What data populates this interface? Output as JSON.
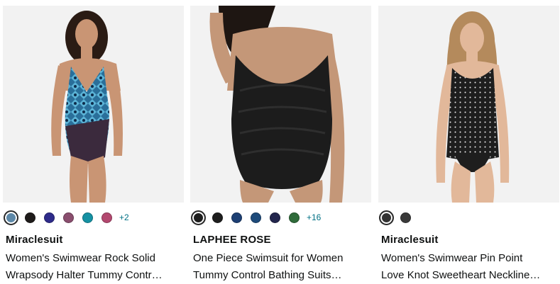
{
  "products": [
    {
      "brand": "Miraclesuit",
      "title_line1": "Women's Swimwear Rock Solid",
      "title_line2": "Wrapsody Halter Tummy Contr…",
      "image": "woman-in-blue-patterned-halter-swimsuit",
      "swatches": [
        "#5d88a8",
        "#1e1b1a",
        "#2e2b8a",
        "#8a4e6e",
        "#1591a3",
        "#b3486f"
      ],
      "more_colors": "+2"
    },
    {
      "brand": "LAPHEE ROSE",
      "title_line1": "One Piece Swimsuit for Women",
      "title_line2": "Tummy Control Bathing Suits…",
      "image": "woman-in-black-ruched-one-piece",
      "swatches": [
        "#1e1e1e",
        "#1e1e1e",
        "#1d3f73",
        "#1e4a7a",
        "#22264d",
        "#2f6b3a"
      ],
      "more_colors": "+16"
    },
    {
      "brand": "Miraclesuit",
      "title_line1": "Women's Swimwear Pin Point",
      "title_line2": "Love Knot Sweetheart Neckline…",
      "image": "woman-in-black-polka-dot-tankini",
      "swatches": [
        "#333333",
        "#3a3a3a"
      ],
      "more_colors": ""
    }
  ]
}
